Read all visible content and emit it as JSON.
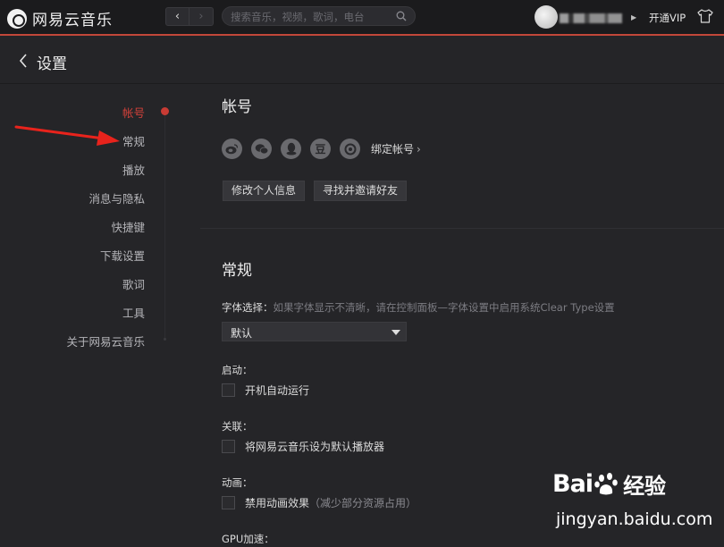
{
  "titlebar": {
    "app_name": "网易云音乐",
    "nav_back": "‹",
    "nav_forward": "›",
    "search_placeholder": "搜索音乐，视频，歌词，电台",
    "vip_label": "开通VIP",
    "user_caret": "▶"
  },
  "header": {
    "back_label": "‹",
    "title": "设置"
  },
  "settings_nav": {
    "items": [
      {
        "label": "帐号",
        "active": true
      },
      {
        "label": "常规",
        "active": false
      },
      {
        "label": "播放",
        "active": false
      },
      {
        "label": "消息与隐私",
        "active": false
      },
      {
        "label": "快捷键",
        "active": false
      },
      {
        "label": "下载设置",
        "active": false
      },
      {
        "label": "歌词",
        "active": false
      },
      {
        "label": "工具",
        "active": false
      },
      {
        "label": "关于网易云音乐",
        "active": false
      }
    ]
  },
  "account": {
    "title": "帐号",
    "bind_icons": [
      "weibo-icon",
      "wechat-icon",
      "qq-icon",
      "douban-icon",
      "yixin-icon"
    ],
    "douban_glyph": "豆",
    "bind_link": "绑定帐号",
    "bind_caret": "›",
    "edit_profile_button": "修改个人信息",
    "invite_friends_button": "寻找并邀请好友"
  },
  "general": {
    "title": "常规",
    "font_label": "字体选择：",
    "font_hint": "如果字体显示不清晰，请在控制面板—字体设置中启用系统Clear Type设置",
    "font_value": "默认",
    "startup_label": "启动：",
    "startup_option": "开机自动运行",
    "association_label": "关联：",
    "association_option": "将网易云音乐设为默认播放器",
    "animation_label": "动画：",
    "animation_option": "禁用动画效果",
    "animation_hint": "（减少部分资源占用）",
    "gpu_label": "GPU加速："
  },
  "watermark": {
    "brand_left": "Bai",
    "brand_right": "经验",
    "url": "jingyan.baidu.com"
  },
  "colors": {
    "accent": "#c83b34",
    "background": "#252528",
    "titlebar": "#1b1b1d",
    "annotation_arrow": "#e8231c"
  }
}
